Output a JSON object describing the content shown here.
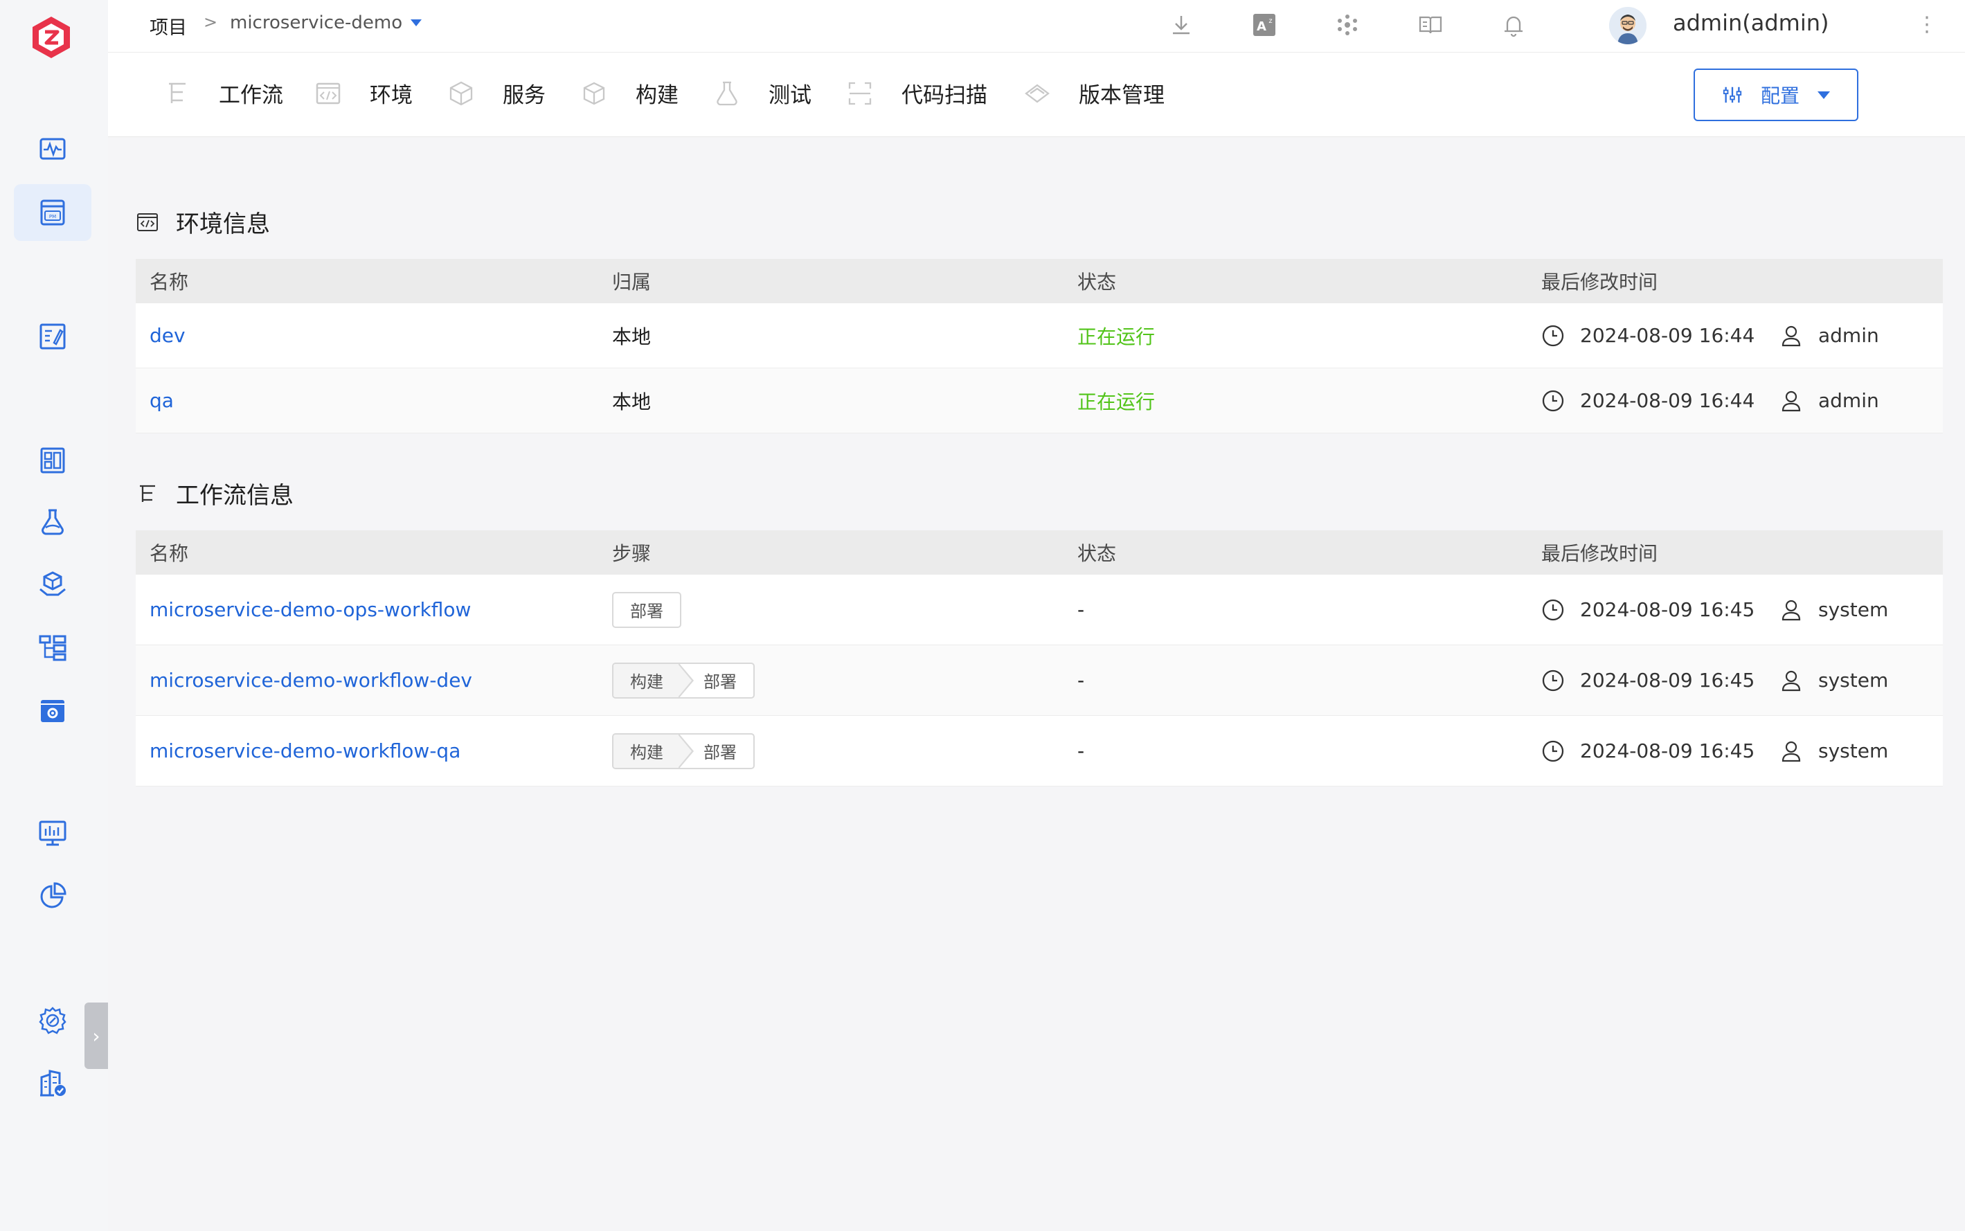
{
  "colors": {
    "accent": "#2f6fde",
    "link": "#1f64d8",
    "running": "#52c41a",
    "logo": "#e8334a"
  },
  "sidebar": {
    "items": [
      {
        "icon": "pulse-monitor-icon",
        "active": false
      },
      {
        "icon": "project-pm-icon",
        "active": true
      },
      {
        "icon": "edit-doc-icon",
        "active": false
      },
      {
        "icon": "dashboard-grid-icon",
        "active": false
      },
      {
        "icon": "flask-icon",
        "active": false
      },
      {
        "icon": "package-hand-icon",
        "active": false
      },
      {
        "icon": "hierarchy-icon",
        "active": false
      },
      {
        "icon": "settings-box-icon",
        "active": false
      },
      {
        "icon": "monitor-chart-icon",
        "active": false
      },
      {
        "icon": "pie-chart-icon",
        "active": false
      },
      {
        "icon": "system-gear-icon",
        "active": false
      },
      {
        "icon": "building-check-icon",
        "active": false
      }
    ],
    "collapse_glyph": "›"
  },
  "header": {
    "crumb_root": "项目",
    "crumb_sep": ">",
    "project_name": "microservice-demo",
    "icons": [
      "download-icon",
      "translate-icon",
      "plugins-icon",
      "docs-book-icon",
      "bell-icon"
    ],
    "user": "admin(admin)",
    "more": "⋮"
  },
  "tabs": [
    {
      "icon": "workflow-icon",
      "label": "工作流"
    },
    {
      "icon": "environment-code-icon",
      "label": "环境"
    },
    {
      "icon": "service-cube-icon",
      "label": "服务"
    },
    {
      "icon": "build-box-icon",
      "label": "构建"
    },
    {
      "icon": "test-flask-icon",
      "label": "测试"
    },
    {
      "icon": "scan-icon",
      "label": "代码扫描"
    },
    {
      "icon": "version-gem-icon",
      "label": "版本管理"
    }
  ],
  "config_button": {
    "label": "配置"
  },
  "env_section": {
    "title": "环境信息",
    "headers": [
      "名称",
      "归属",
      "状态",
      "最后修改时间"
    ],
    "rows": [
      {
        "name": "dev",
        "owner": "本地",
        "status": "正在运行",
        "time": "2024-08-09 16:44",
        "user": "admin"
      },
      {
        "name": "qa",
        "owner": "本地",
        "status": "正在运行",
        "time": "2024-08-09 16:44",
        "user": "admin"
      }
    ]
  },
  "workflow_section": {
    "title": "工作流信息",
    "headers": [
      "名称",
      "步骤",
      "状态",
      "最后修改时间"
    ],
    "rows": [
      {
        "name": "microservice-demo-ops-workflow",
        "steps": [
          "部署"
        ],
        "status": "-",
        "time": "2024-08-09 16:45",
        "user": "system"
      },
      {
        "name": "microservice-demo-workflow-dev",
        "steps": [
          "构建",
          "部署"
        ],
        "status": "-",
        "time": "2024-08-09 16:45",
        "user": "system"
      },
      {
        "name": "microservice-demo-workflow-qa",
        "steps": [
          "构建",
          "部署"
        ],
        "status": "-",
        "time": "2024-08-09 16:45",
        "user": "system"
      }
    ]
  }
}
